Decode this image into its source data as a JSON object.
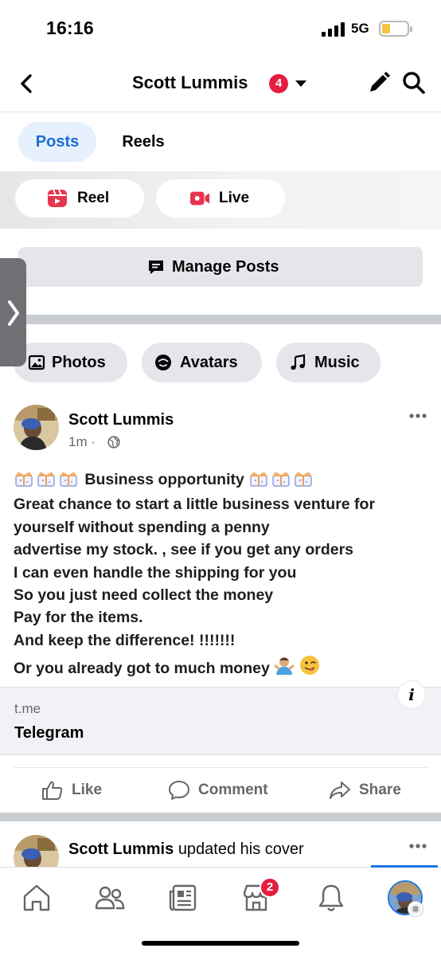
{
  "status_bar": {
    "time": "16:16",
    "network": "5G"
  },
  "header": {
    "title": "Scott Lummis",
    "notification_count": "4"
  },
  "tabs": [
    {
      "label": "Posts"
    },
    {
      "label": "Reels"
    }
  ],
  "create": {
    "reel_label": "Reel",
    "live_label": "Live"
  },
  "manage": {
    "label": "Manage Posts"
  },
  "filters": [
    {
      "label": "Photos"
    },
    {
      "label": "Avatars"
    },
    {
      "label": "Music"
    }
  ],
  "post": {
    "author": "Scott Lummis",
    "meta": "1m ·",
    "lines": [
      "Business opportunity",
      "Great chance to start a little business venture for",
      "yourself without spending a penny",
      "advertise my stock. , see if you get any orders",
      "I can even handle the shipping for you",
      "So you just need collect the money",
      "Pay for the items.",
      "And keep the difference! !!!!!!!",
      "Or you already got to much money"
    ],
    "link": {
      "domain": "t.me",
      "title": "Telegram"
    },
    "actions": {
      "like": "Like",
      "comment": "Comment",
      "share": "Share"
    }
  },
  "next_post": {
    "author": "Scott Lummis",
    "text": "updated his cover"
  },
  "bottom_nav": {
    "marketplace_badge": "2"
  },
  "colors": {
    "accent": "#1b74e4",
    "badge": "#e41e3f",
    "chip_bg": "#e4e6eb",
    "tab_active_bg": "#e7f0fd"
  }
}
